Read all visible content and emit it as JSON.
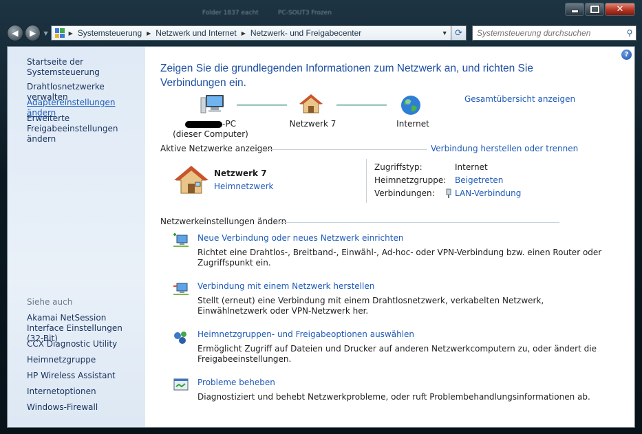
{
  "window": {
    "blurred_titles": [
      "Folder 1837 eacht",
      "PC-SOUT3 Frozen"
    ]
  },
  "address": {
    "crumbs": [
      "Systemsteuerung",
      "Netzwerk und Internet",
      "Netzwerk- und Freigabecenter"
    ]
  },
  "search": {
    "placeholder": "Systemsteuerung durchsuchen"
  },
  "sidebar": {
    "links": [
      {
        "label": "Startseite der Systemsteuerung"
      },
      {
        "label": "Drahtlosnetzwerke verwalten"
      },
      {
        "label": "Adaptereinstellungen ändern"
      },
      {
        "label": "Erweiterte Freigabeeinstellungen ändern"
      }
    ],
    "see_also_heading": "Siehe auch",
    "see_also": [
      {
        "label": "Akamai NetSession Interface Einstellungen (32-Bit)"
      },
      {
        "label": "CCX Diagnostic Utility"
      },
      {
        "label": "Heimnetzgruppe"
      },
      {
        "label": "HP Wireless Assistant"
      },
      {
        "label": "Internetoptionen"
      },
      {
        "label": "Windows-Firewall"
      }
    ]
  },
  "main": {
    "title": "Zeigen Sie die grundlegenden Informationen zum Netzwerk an, und richten Sie Verbindungen ein.",
    "overview_link": "Gesamtübersicht anzeigen",
    "map": {
      "computer_suffix": "-PC",
      "computer_sub": "(dieser Computer)",
      "network": "Netzwerk  7",
      "internet": "Internet"
    },
    "active_networks": {
      "heading": "Aktive Netzwerke anzeigen",
      "connect_link": "Verbindung herstellen oder trennen",
      "name": "Netzwerk  7",
      "type_link": "Heimnetzwerk",
      "props": [
        {
          "label": "Zugriffstyp:",
          "value": "Internet"
        },
        {
          "label": "Heimnetzgruppe:",
          "value": "Beigetreten"
        },
        {
          "label": "Verbindungen:",
          "value": "LAN-Verbindung"
        }
      ]
    },
    "settings": {
      "heading": "Netzwerkeinstellungen ändern",
      "tasks": [
        {
          "title": "Neue Verbindung oder neues Netzwerk einrichten",
          "desc": "Richtet eine Drahtlos-, Breitband-, Einwähl-, Ad-hoc- oder VPN-Verbindung bzw. einen Router oder Zugriffspunkt ein."
        },
        {
          "title": "Verbindung mit einem Netzwerk herstellen",
          "desc": "Stellt (erneut) eine Verbindung mit einem Drahtlosnetzwerk, verkabelten Netzwerk, Einwählnetzwerk oder VPN-Netzwerk her."
        },
        {
          "title": "Heimnetzgruppen- und Freigabeoptionen auswählen",
          "desc": "Ermöglicht Zugriff auf Dateien und Drucker auf anderen Netzwerkcomputern zu, oder ändert die Freigabeeinstellungen."
        },
        {
          "title": "Probleme beheben",
          "desc": "Diagnostiziert und behebt Netzwerkprobleme, oder ruft Problembehandlungsinformationen ab."
        }
      ]
    }
  },
  "colors": {
    "link": "#1d5ab8",
    "title": "#1e4fa3",
    "sidebar": "#dfeaf6"
  }
}
